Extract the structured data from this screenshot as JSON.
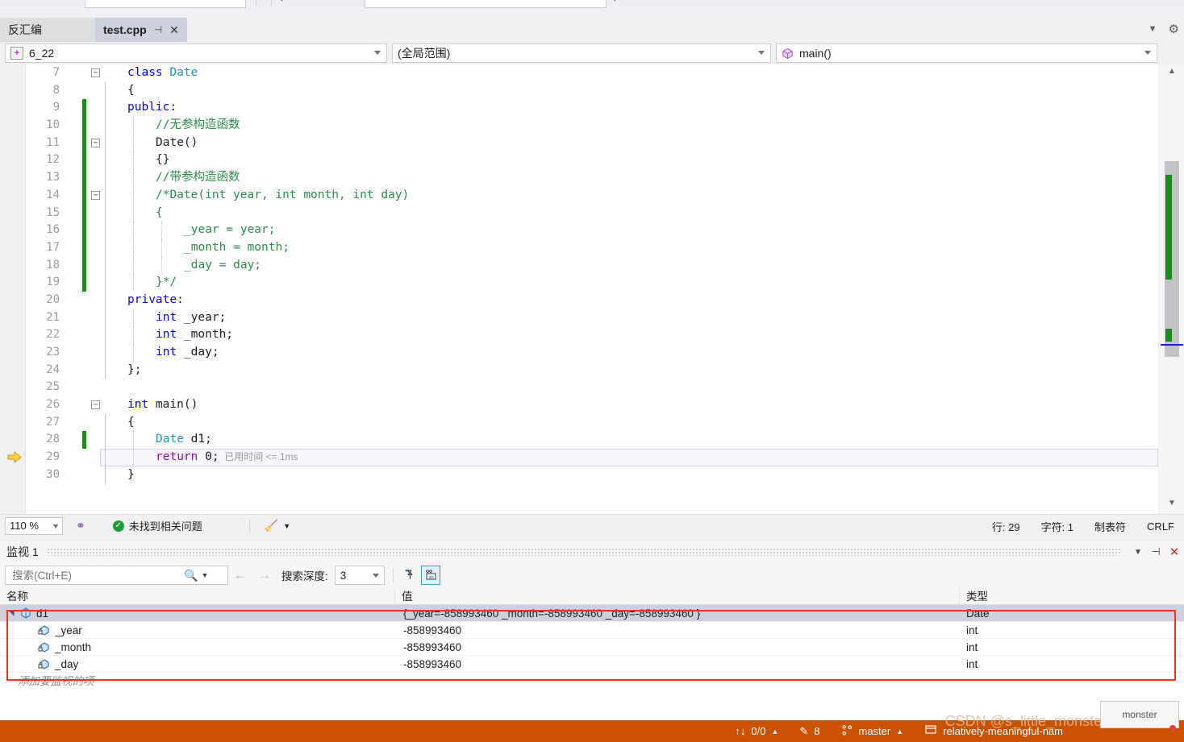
{
  "window": {
    "tabs": [
      {
        "label": "反汇编",
        "active": false,
        "name": "tab-disassembly"
      },
      {
        "label": "test.cpp",
        "active": true,
        "name": "tab-test-cpp"
      }
    ],
    "tab_pin_icon": "pin-icon",
    "tab_close_icon": "close-icon",
    "tabrow_overflow_icon": "chevron-down-icon",
    "tabrow_settings_icon": "gear-icon"
  },
  "navbar": {
    "project": "6_22",
    "project_icon": "project-add-icon",
    "scope": "(全局范围)",
    "member": "main()",
    "member_icon": "method-cube-icon",
    "splitter_icon": "split-window-icon",
    "caret_icon": "chevron-down-icon"
  },
  "editor": {
    "current_line_arrow_icon": "execution-pointer-icon",
    "inline_timing": "已用时间 <= 1ms",
    "lines": [
      {
        "no": "7",
        "change": false,
        "fold": "minus",
        "indent": 0,
        "tokens": [
          {
            "t": "class ",
            "c": "blue"
          },
          {
            "t": "Date",
            "c": "class"
          }
        ]
      },
      {
        "no": "8",
        "change": false,
        "fold": "",
        "indent": 0,
        "tokens": [
          {
            "t": "{",
            "c": "plain"
          }
        ]
      },
      {
        "no": "9",
        "change": true,
        "fold": "",
        "indent": 0,
        "tokens": [
          {
            "t": "public",
            "c": "blue"
          },
          {
            "t": ":",
            "c": "plain"
          }
        ]
      },
      {
        "no": "10",
        "change": true,
        "fold": "",
        "indent": 1,
        "tokens": [
          {
            "t": "//无参构造函数",
            "c": "cmt"
          }
        ]
      },
      {
        "no": "11",
        "change": true,
        "fold": "minus",
        "indent": 1,
        "tokens": [
          {
            "t": "Date()",
            "c": "plain"
          }
        ]
      },
      {
        "no": "12",
        "change": true,
        "fold": "",
        "indent": 1,
        "tokens": [
          {
            "t": "{}",
            "c": "plain"
          }
        ]
      },
      {
        "no": "13",
        "change": true,
        "fold": "",
        "indent": 1,
        "tokens": [
          {
            "t": "//带参构造函数",
            "c": "cmt"
          }
        ]
      },
      {
        "no": "14",
        "change": true,
        "fold": "minus",
        "indent": 1,
        "tokens": [
          {
            "t": "/*Date(int year, int month, int day)",
            "c": "cmt"
          }
        ]
      },
      {
        "no": "15",
        "change": true,
        "fold": "",
        "indent": 1,
        "tokens": [
          {
            "t": "{",
            "c": "cmt"
          }
        ]
      },
      {
        "no": "16",
        "change": true,
        "fold": "",
        "indent": 2,
        "tokens": [
          {
            "t": "_year = year;",
            "c": "cmt"
          }
        ]
      },
      {
        "no": "17",
        "change": true,
        "fold": "",
        "indent": 2,
        "tokens": [
          {
            "t": "_month = month;",
            "c": "cmt"
          }
        ]
      },
      {
        "no": "18",
        "change": true,
        "fold": "",
        "indent": 2,
        "tokens": [
          {
            "t": "_day = day;",
            "c": "cmt"
          }
        ]
      },
      {
        "no": "19",
        "change": true,
        "fold": "",
        "indent": 1,
        "tokens": [
          {
            "t": "}*/",
            "c": "cmt"
          }
        ]
      },
      {
        "no": "20",
        "change": false,
        "fold": "",
        "indent": 0,
        "tokens": [
          {
            "t": "private",
            "c": "blue"
          },
          {
            "t": ":",
            "c": "plain"
          }
        ]
      },
      {
        "no": "21",
        "change": false,
        "fold": "",
        "indent": 1,
        "tokens": [
          {
            "t": "int",
            "c": "blue"
          },
          {
            "t": " _year;",
            "c": "plain"
          }
        ]
      },
      {
        "no": "22",
        "change": false,
        "fold": "",
        "indent": 1,
        "tokens": [
          {
            "t": "int",
            "c": "blue"
          },
          {
            "t": " _month;",
            "c": "plain"
          }
        ]
      },
      {
        "no": "23",
        "change": false,
        "fold": "",
        "indent": 1,
        "tokens": [
          {
            "t": "int",
            "c": "blue"
          },
          {
            "t": " _day;",
            "c": "plain"
          }
        ]
      },
      {
        "no": "24",
        "change": false,
        "fold": "",
        "indent": 0,
        "tokens": [
          {
            "t": "};",
            "c": "plain"
          }
        ]
      },
      {
        "no": "25",
        "change": false,
        "fold": "",
        "indent": 0,
        "tokens": []
      },
      {
        "no": "26",
        "change": false,
        "fold": "minus",
        "indent": 0,
        "tokens": [
          {
            "t": "int",
            "c": "blue"
          },
          {
            "t": " main()",
            "c": "plain"
          }
        ]
      },
      {
        "no": "27",
        "change": false,
        "fold": "",
        "indent": 0,
        "tokens": [
          {
            "t": "{",
            "c": "plain"
          }
        ]
      },
      {
        "no": "28",
        "change": true,
        "fold": "",
        "indent": 1,
        "tokens": [
          {
            "t": "Date",
            "c": "class"
          },
          {
            "t": " d1;",
            "c": "plain"
          }
        ]
      },
      {
        "no": "29",
        "change": false,
        "fold": "",
        "indent": 1,
        "tokens": [
          {
            "t": "return",
            "c": "purple"
          },
          {
            "t": " 0;",
            "c": "plain"
          }
        ]
      },
      {
        "no": "30",
        "change": false,
        "fold": "",
        "indent": 0,
        "tokens": [
          {
            "t": "}",
            "c": "plain"
          }
        ]
      }
    ]
  },
  "editor_status": {
    "zoom": "110 %",
    "zoom_caret_icon": "chevron-down-icon",
    "intellisense_icon": "intellisense-icon",
    "issues_status": "未找到相关问题",
    "issues_ok_icon": "check-circle-icon",
    "cleanup_icon": "code-cleanup-broom-icon",
    "cleanup_caret_icon": "chevron-down-icon",
    "line": "行: 29",
    "column": "字符: 1",
    "tabs_mode": "制表符",
    "line_endings": "CRLF"
  },
  "watch": {
    "title": "监视 1",
    "overflow_icon": "chevron-down-icon",
    "pin_icon": "pin-icon",
    "close_icon": "close-icon",
    "search_placeholder": "搜索(Ctrl+E)",
    "search_value": "",
    "search_icon": "magnifier-icon",
    "search_caret_icon": "chevron-down-icon",
    "prev_icon": "arrow-left-icon",
    "next_icon": "arrow-right-icon",
    "depth_label": "搜索深度:",
    "depth_value": "3",
    "depth_caret_icon": "chevron-down-icon",
    "pin_column_icon": "pin-filter-icon",
    "hex_toggle_icon": "hex-display-icon",
    "columns": [
      "名称",
      "值",
      "类型"
    ],
    "rows": [
      {
        "name": "d1",
        "value": "{_year=-858993460 _month=-858993460 _day=-858993460 }",
        "type": "Date",
        "icon": "object-diamond-icon",
        "expander": "expanded",
        "depth": 0,
        "selected": true
      },
      {
        "name": "_year",
        "value": "-858993460",
        "type": "int",
        "icon": "private-field-icon",
        "expander": "",
        "depth": 1,
        "selected": false
      },
      {
        "name": "_month",
        "value": "-858993460",
        "type": "int",
        "icon": "private-field-icon",
        "expander": "",
        "depth": 1,
        "selected": false
      },
      {
        "name": "_day",
        "value": "-858993460",
        "type": "int",
        "icon": "private-field-icon",
        "expander": "",
        "depth": 1,
        "selected": false
      }
    ],
    "add_row_placeholder": "添加要监视的项"
  },
  "bottom_bar": {
    "sync_icon": "updown-arrows-icon",
    "sync_counts": "0/0",
    "sync_caret_icon": "chevron-up-icon",
    "pencil_icon": "pencil-icon",
    "pending_changes": "8",
    "branch_icon": "git-branch-icon",
    "branch": "master",
    "branch_caret_icon": "chevron-up-icon",
    "repo_icon": "repository-icon",
    "repo": "relatively-meaningful-nam",
    "notification_icon": "notification-bell-icon",
    "watermark": "CSDN @s_little_monster"
  },
  "colors": {
    "accent_orange": "#ca5100",
    "highlight_red": "#ef3124",
    "change_green": "#1d8a1d",
    "selection": "#cfd0dd",
    "keyword_blue": "#0000ff",
    "comment_green": "#2f8a4f",
    "type_teal": "#2b91af",
    "keyword_purple": "#8f08c4"
  }
}
